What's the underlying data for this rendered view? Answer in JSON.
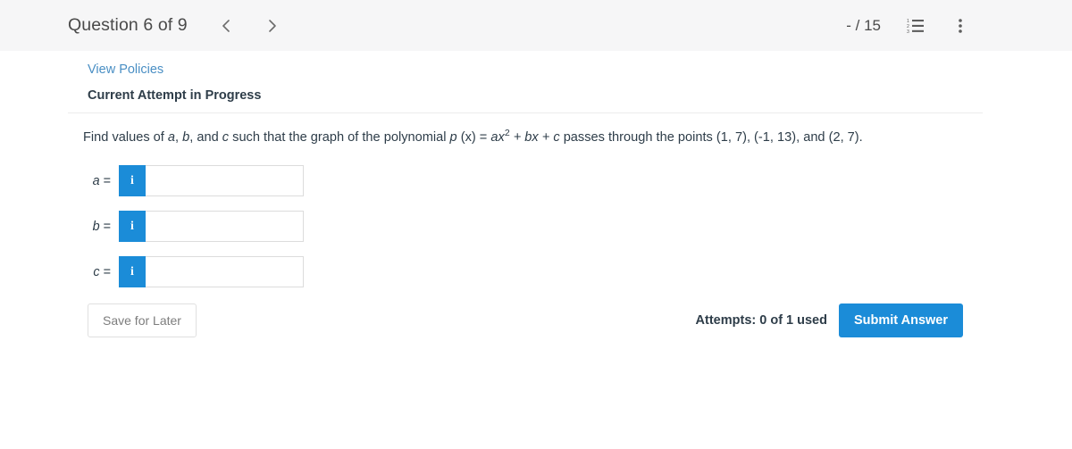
{
  "header": {
    "question_title": "Question 6 of 9",
    "prev_icon": "chevron-left-icon",
    "next_icon": "chevron-right-icon",
    "score": "- / 15",
    "list_icon": "ordered-list-icon",
    "menu_icon": "more-vertical-icon"
  },
  "card": {
    "view_policies_label": "View Policies",
    "attempt_status": "Current Attempt in Progress",
    "question": {
      "part1": "Find values of ",
      "var_a": "a",
      "comma1": ", ",
      "var_b": "b",
      "part2": ", and ",
      "var_c": "c",
      "part3": " such that the graph of the polynomial ",
      "poly_p": "p",
      "poly_x": " (x)",
      "equals": " = ",
      "poly_ax": "ax",
      "poly_exp": "2",
      "poly_rest_bx": " + bx",
      "poly_plus_c": " + c",
      "part4": " passes through the points (1, 7), (-1, 13), and (2, 7).",
      "full_text": "Find values of a, b, and c such that the graph of the polynomial p (x) = ax2 + bx + c passes through the points (1, 7), (-1, 13), and (2, 7)."
    },
    "answers": [
      {
        "label_var": "a",
        "label_eq": " =",
        "info_icon": "info-icon",
        "info_glyph": "i",
        "value": "",
        "placeholder": ""
      },
      {
        "label_var": "b",
        "label_eq": " =",
        "info_icon": "info-icon",
        "info_glyph": "i",
        "value": "",
        "placeholder": ""
      },
      {
        "label_var": "c",
        "label_eq": " =",
        "info_icon": "info-icon",
        "info_glyph": "i",
        "value": "",
        "placeholder": ""
      }
    ]
  },
  "footer": {
    "save_label": "Save for Later",
    "attempts_text": "Attempts: 0 of 1 used",
    "submit_label": "Submit Answer"
  },
  "colors": {
    "accent_blue": "#1b8cd8",
    "link_blue": "#4a8fc4",
    "topbar_bg": "#f6f6f7",
    "text_dark": "#2e3d49"
  }
}
